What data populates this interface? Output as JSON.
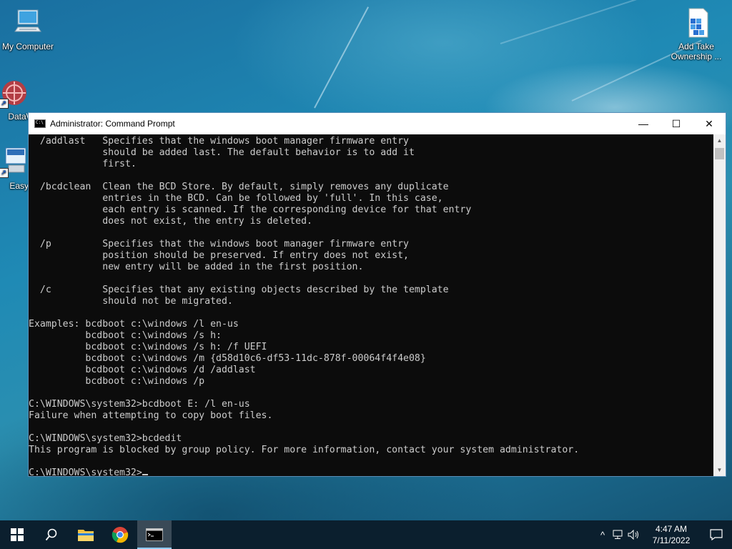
{
  "desktop": {
    "icons": [
      {
        "label": "My Computer"
      },
      {
        "label": "DataW"
      },
      {
        "label": "EasyB"
      },
      {
        "label_line1": "Add Take",
        "label_line2": "Ownership ..."
      }
    ]
  },
  "window": {
    "title": "Administrator: Command Prompt",
    "icon_text": "C:\\",
    "minimize_glyph": "—",
    "maximize_glyph": "☐",
    "close_glyph": "✕",
    "console_lines": [
      "  /addlast   Specifies that the windows boot manager firmware entry",
      "             should be added last. The default behavior is to add it",
      "             first.",
      "",
      "  /bcdclean  Clean the BCD Store. By default, simply removes any duplicate",
      "             entries in the BCD. Can be followed by 'full'. In this case,",
      "             each entry is scanned. If the corresponding device for that entry",
      "             does not exist, the entry is deleted.",
      "",
      "  /p         Specifies that the windows boot manager firmware entry",
      "             position should be preserved. If entry does not exist,",
      "             new entry will be added in the first position.",
      "",
      "  /c         Specifies that any existing objects described by the template",
      "             should not be migrated.",
      "",
      "Examples: bcdboot c:\\windows /l en-us",
      "          bcdboot c:\\windows /s h:",
      "          bcdboot c:\\windows /s h: /f UEFI",
      "          bcdboot c:\\windows /m {d58d10c6-df53-11dc-878f-00064f4f4e08}",
      "          bcdboot c:\\windows /d /addlast",
      "          bcdboot c:\\windows /p",
      "",
      "C:\\WINDOWS\\system32>bcdboot E: /l en-us",
      "Failure when attempting to copy boot files.",
      "",
      "C:\\WINDOWS\\system32>bcdedit",
      "This program is blocked by group policy. For more information, contact your system administrator.",
      ""
    ],
    "prompt": "C:\\WINDOWS\\system32>"
  },
  "taskbar": {
    "clock_time": "4:47 AM",
    "clock_date": "7/11/2022",
    "tray_chevron": "^",
    "colors": {
      "background": "#0b1f2e",
      "active_underline": "#8ecbff"
    }
  }
}
